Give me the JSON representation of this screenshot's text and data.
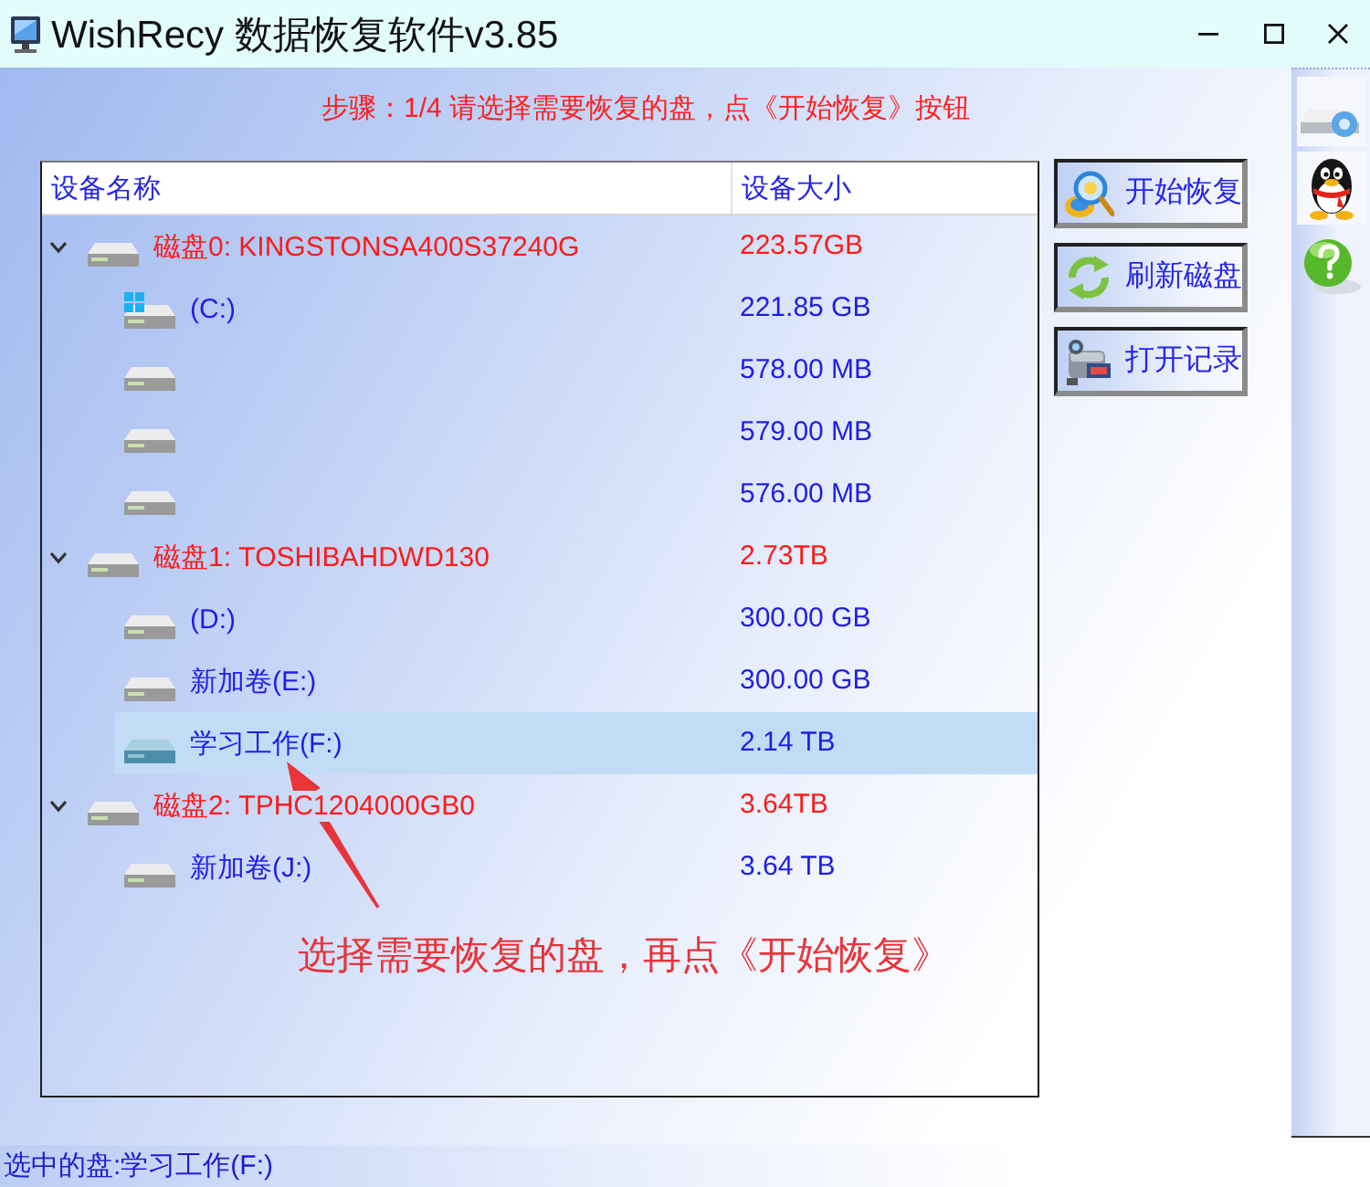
{
  "window": {
    "title": "WishRecy 数据恢复软件v3.85"
  },
  "step_hint": "步骤：1/4 请选择需要恢复的盘，点《开始恢复》按钮",
  "device_list": {
    "columns": [
      "设备名称",
      "设备大小"
    ],
    "disks": [
      {
        "name": "磁盘0: KINGSTONSA400S37240G",
        "size": "223.57GB",
        "expanded": true,
        "selected": false,
        "children": [
          {
            "name": "(C:)",
            "size": "221.85 GB",
            "system": true,
            "selected": false
          },
          {
            "size": "578.00 MB",
            "system": false,
            "selected": false
          },
          {
            "size": "579.00 MB",
            "system": false,
            "selected": false
          },
          {
            "size": "576.00 MB",
            "system": false,
            "selected": false
          }
        ]
      },
      {
        "name": "磁盘1: TOSHIBAHDWD130",
        "size": "2.73TB",
        "expanded": true,
        "selected": false,
        "children": [
          {
            "name": "(D:)",
            "size": "300.00 GB",
            "system": false,
            "selected": false
          },
          {
            "name": "新加卷(E:)",
            "size": "300.00 GB",
            "system": false,
            "selected": false
          },
          {
            "name": "学习工作(F:)",
            "size": "2.14 TB",
            "system": false,
            "selected": true
          }
        ]
      },
      {
        "name": "磁盘2: TPHC1204000GB0",
        "size": "3.64TB",
        "expanded": true,
        "selected": false,
        "children": [
          {
            "name": "新加卷(J:)",
            "size": "3.64 TB",
            "system": false,
            "selected": false
          }
        ]
      }
    ]
  },
  "buttons": [
    {
      "label": "开始恢复",
      "kind": "start"
    },
    {
      "label": "刷新磁盘",
      "kind": "refresh"
    },
    {
      "label": "打开记录",
      "kind": "log"
    }
  ],
  "annotation": {
    "text": "选择需要恢复的盘，再点《开始恢复》"
  },
  "status_bar": {
    "text": "选中的盘:学习工作(F:)"
  }
}
